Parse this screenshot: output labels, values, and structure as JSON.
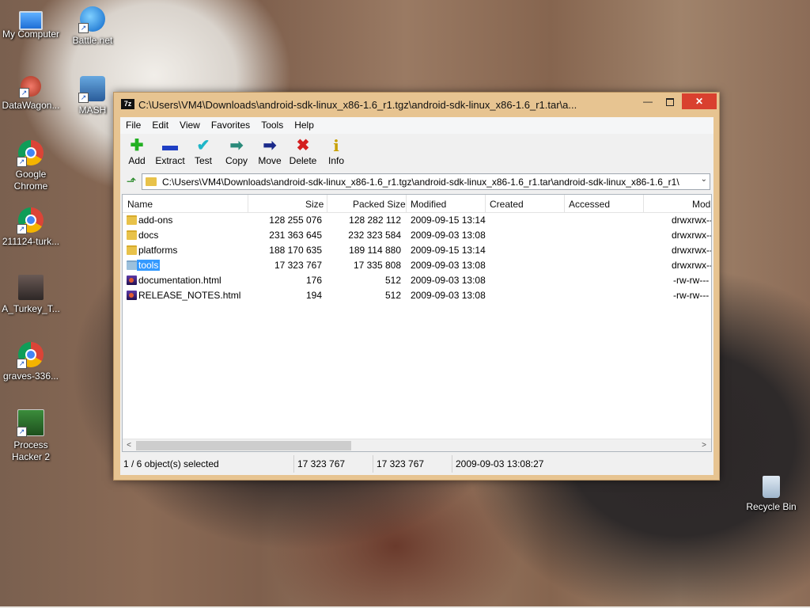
{
  "desktop": {
    "icons": [
      {
        "label": "My Computer",
        "icon": "computer-icon"
      },
      {
        "label": "Battle.net",
        "icon": "battlenet-icon"
      },
      {
        "label": "DataWagon...",
        "icon": "datawagon-icon"
      },
      {
        "label": "MASH",
        "icon": "mash-icon"
      },
      {
        "label": "Google Chrome",
        "icon": "chrome-icon"
      },
      {
        "label": "211124-turk...",
        "icon": "chrome-icon"
      },
      {
        "label": "A_Turkey_T...",
        "icon": "image-icon"
      },
      {
        "label": "graves-336...",
        "icon": "chrome-icon"
      },
      {
        "label": "Process Hacker 2",
        "icon": "process-hacker-icon"
      },
      {
        "label": "Recycle Bin",
        "icon": "recycle-bin-icon"
      }
    ]
  },
  "window": {
    "app_icon_text": "7z",
    "title": "C:\\Users\\VM4\\Downloads\\android-sdk-linux_x86-1.6_r1.tgz\\android-sdk-linux_x86-1.6_r1.tar\\a...",
    "close_glyph": "✕",
    "min_glyph": "—"
  },
  "menu": [
    "File",
    "Edit",
    "View",
    "Favorites",
    "Tools",
    "Help"
  ],
  "toolbar": [
    {
      "label": "Add",
      "icon": "plus-icon",
      "glyph": "✚",
      "color": "#22b022"
    },
    {
      "label": "Extract",
      "icon": "minus-icon",
      "glyph": "▬",
      "color": "#1f3fc4"
    },
    {
      "label": "Test",
      "icon": "check-icon",
      "glyph": "✔",
      "color": "#1fb6c8"
    },
    {
      "label": "Copy",
      "icon": "copy-arrow-icon",
      "glyph": "➡",
      "color": "#2a8a7a"
    },
    {
      "label": "Move",
      "icon": "move-arrow-icon",
      "glyph": "➡",
      "color": "#1b2a8a"
    },
    {
      "label": "Delete",
      "icon": "delete-x-icon",
      "glyph": "✖",
      "color": "#d42020"
    },
    {
      "label": "Info",
      "icon": "info-icon",
      "glyph": "i",
      "color": "#c8a000"
    }
  ],
  "address": {
    "path": "C:\\Users\\VM4\\Downloads\\android-sdk-linux_x86-1.6_r1.tgz\\android-sdk-linux_x86-1.6_r1.tar\\android-sdk-linux_x86-1.6_r1\\",
    "dropdown_glyph": "⌄",
    "up_glyph": "⬏"
  },
  "columns": [
    "Name",
    "Size",
    "Packed Size",
    "Modified",
    "Created",
    "Accessed",
    "Mod"
  ],
  "files": [
    {
      "name": "add-ons",
      "type": "folder",
      "size": "128 255 076",
      "packed": "128 282 112",
      "modified": "2009-09-15 13:14",
      "mode": "drwxrwx--"
    },
    {
      "name": "docs",
      "type": "folder",
      "size": "231 363 645",
      "packed": "232 323 584",
      "modified": "2009-09-03 13:08",
      "mode": "drwxrwx--"
    },
    {
      "name": "platforms",
      "type": "folder",
      "size": "188 170 635",
      "packed": "189 114 880",
      "modified": "2009-09-15 13:14",
      "mode": "drwxrwx--"
    },
    {
      "name": "tools",
      "type": "folder",
      "size": "17 323 767",
      "packed": "17 335 808",
      "modified": "2009-09-03 13:08",
      "mode": "drwxrwx--",
      "selected": true
    },
    {
      "name": "documentation.html",
      "type": "html",
      "size": "176",
      "packed": "512",
      "modified": "2009-09-03 13:08",
      "mode": "-rw-rw---"
    },
    {
      "name": "RELEASE_NOTES.html",
      "type": "html",
      "size": "194",
      "packed": "512",
      "modified": "2009-09-03 13:08",
      "mode": "-rw-rw---"
    }
  ],
  "scroll": {
    "left_glyph": "<",
    "right_glyph": ">"
  },
  "status": {
    "selection": "1 / 6 object(s) selected",
    "size": "17 323 767",
    "packed": "17 323 767",
    "modified": "2009-09-03 13:08:27"
  }
}
